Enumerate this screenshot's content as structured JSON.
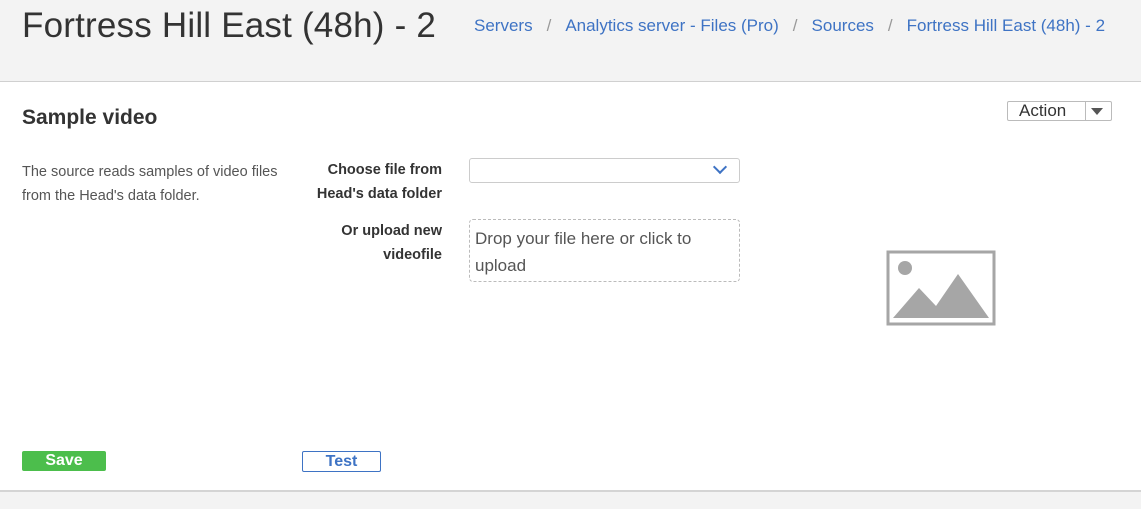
{
  "header": {
    "title": "Fortress Hill East (48h) - 2",
    "breadcrumb": [
      {
        "label": "Servers"
      },
      {
        "label": "Analytics server - Files (Pro)"
      },
      {
        "label": "Sources"
      },
      {
        "label": "Fortress Hill East (48h) - 2"
      }
    ],
    "separator": "/"
  },
  "panel": {
    "title": "Sample video",
    "action_label": "Action",
    "description": "The source reads samples of video files from the Head's data folder.",
    "choose_file_label": "Choose file from Head's data folder",
    "choose_file_value": "",
    "upload_label": "Or upload new videofile",
    "dropzone_text": "Drop your file here or click to upload",
    "preview_icon": "image-placeholder-icon",
    "save_label": "Save",
    "test_label": "Test"
  },
  "colors": {
    "link": "#3e73c4",
    "save": "#4cbe4c",
    "background": "#f3f3f3"
  }
}
